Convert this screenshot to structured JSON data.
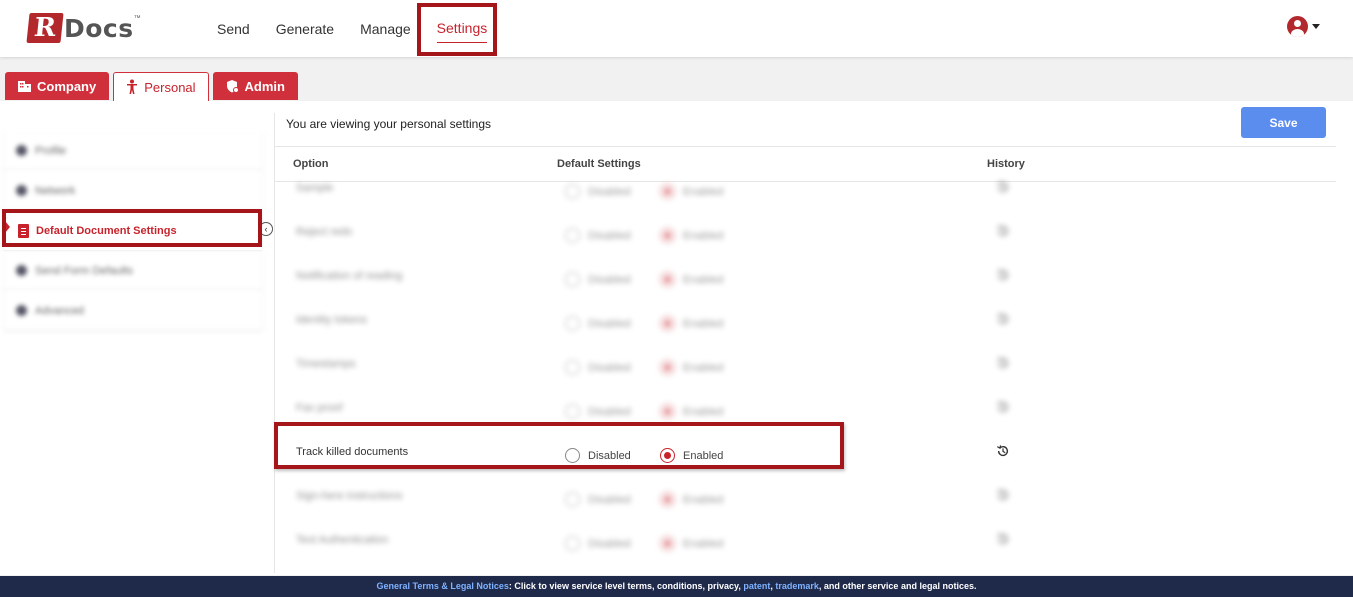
{
  "app": {
    "logo_letter": "R",
    "logo_rest": "Docs",
    "logo_tm": "™"
  },
  "nav": {
    "items": [
      {
        "label": "Send"
      },
      {
        "label": "Generate"
      },
      {
        "label": "Manage"
      },
      {
        "label": "Settings",
        "active": true
      }
    ]
  },
  "tabs": [
    {
      "label": "Company",
      "icon": "building-icon"
    },
    {
      "label": "Personal",
      "icon": "person-icon",
      "active": true
    },
    {
      "label": "Admin",
      "icon": "shield-icon"
    }
  ],
  "sidebar": {
    "items": [
      {
        "label": "Profile",
        "blurred": true
      },
      {
        "label": "Network",
        "blurred": true
      },
      {
        "label": "Default Document Settings",
        "active": true
      },
      {
        "label": "Send Form Defaults",
        "blurred": true
      },
      {
        "label": "Advanced",
        "blurred": true
      }
    ]
  },
  "main": {
    "title": "You are viewing your personal settings",
    "save_label": "Save",
    "columns": {
      "option": "Option",
      "default": "Default Settings",
      "history": "History"
    },
    "radio_labels": {
      "disabled": "Disabled",
      "enabled": "Enabled"
    },
    "rows": [
      {
        "option": "Sample",
        "value": "Enabled",
        "blurred": true
      },
      {
        "option": "Reject redo",
        "value": "Enabled",
        "blurred": true
      },
      {
        "option": "Notification of reading",
        "value": "Enabled",
        "blurred": true
      },
      {
        "option": "Identity tokens",
        "value": "Enabled",
        "blurred": true
      },
      {
        "option": "Timestamps",
        "value": "Enabled",
        "blurred": true
      },
      {
        "option": "Fax proof",
        "value": "Enabled",
        "blurred": true
      },
      {
        "option": "Track killed documents",
        "value": "Enabled",
        "blurred": false
      },
      {
        "option": "Sign-here instructions",
        "value": "Enabled",
        "blurred": true
      },
      {
        "option": "Text Authentication",
        "value": "Enabled",
        "blurred": true
      }
    ]
  },
  "footer": {
    "prefix": "General Terms & Legal Notices",
    "text1": ": Click to view service level terms, conditions, privacy, ",
    "link1": "patent",
    "sep": ", ",
    "link2": "trademark",
    "text2": ", and other service and legal notices."
  },
  "colors": {
    "brand_red": "#c8232c",
    "highlight": "#a4161a",
    "save_blue": "#5b8def",
    "footer_bg": "#1f2a4b"
  }
}
